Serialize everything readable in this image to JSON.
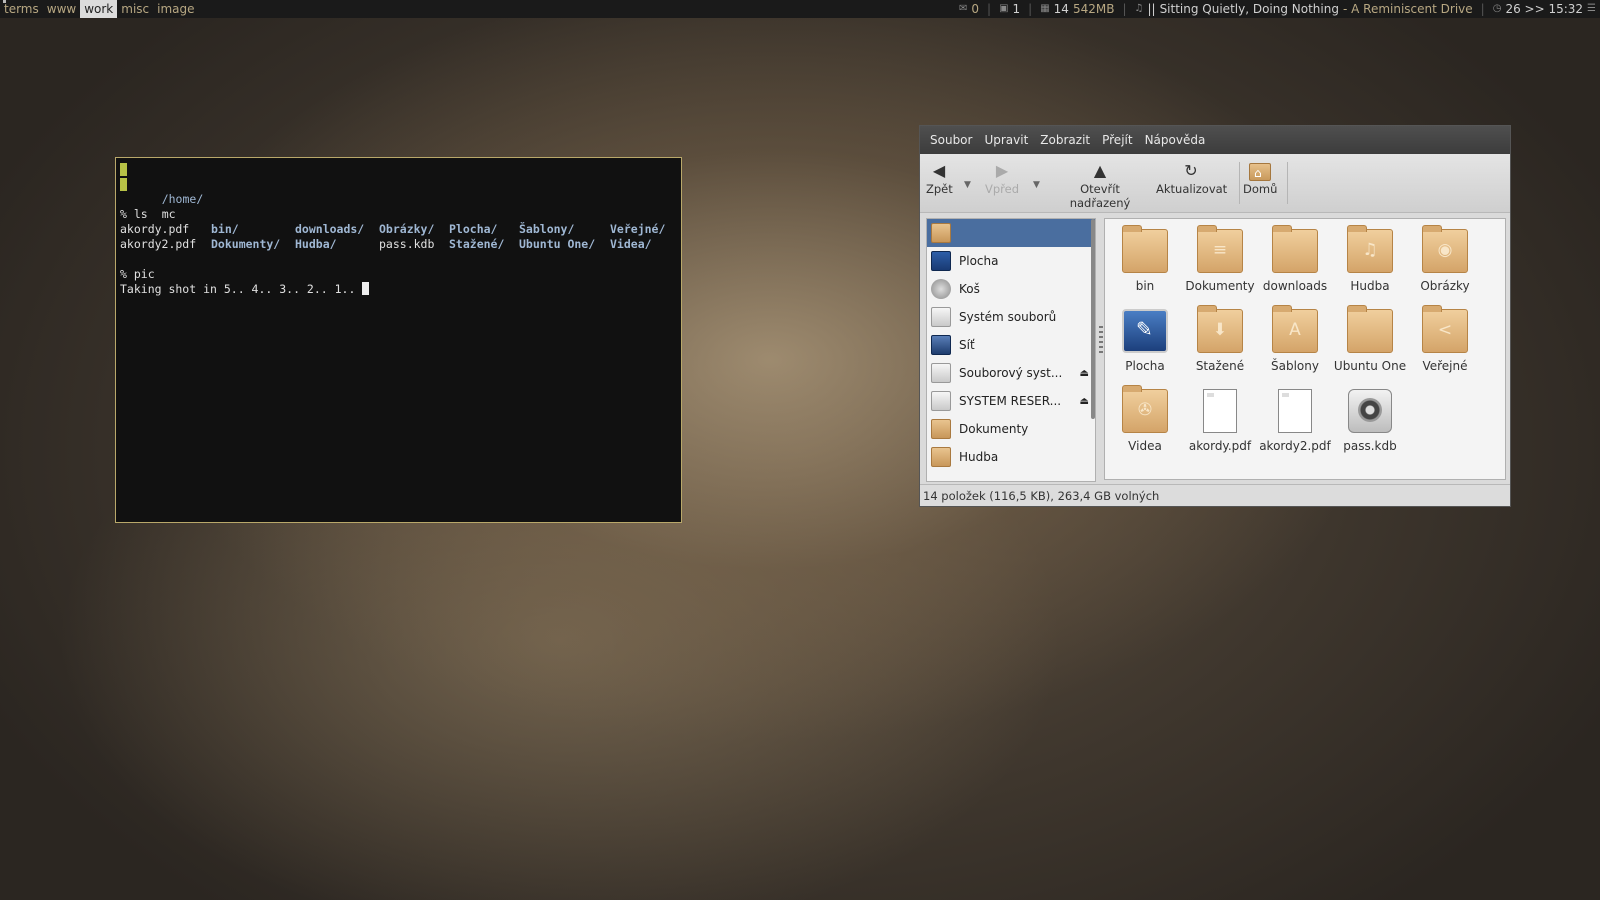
{
  "topbar": {
    "workspaces": [
      "terms",
      "www",
      "work",
      "misc",
      "image"
    ],
    "active_workspace": "work",
    "mail_count": "0",
    "cpu_count": "1",
    "mem_procs": "14",
    "mem_used": "542MB",
    "music_state": "||",
    "song_title": "Sitting Quietly, Doing Nothing",
    "song_artist": "- A Reminiscent Drive",
    "datetime": "26 >> 15:32"
  },
  "terminal": {
    "path": "/home/",
    "mc": "mc",
    "cmd_ls": "% ls",
    "ls_row1": [
      "akordy.pdf",
      "bin/",
      "downloads/",
      "Obrázky/",
      "Plocha/",
      "Šablony/",
      "Veřejné/"
    ],
    "ls_row2": [
      "akordy2.pdf",
      "Dokumenty/",
      "Hudba/",
      "pass.kdb",
      "Stažené/",
      "Ubuntu One/",
      "Videa/"
    ],
    "cmd_pic": "% pic",
    "shot_line": "Taking shot in 5.. 4.. 3.. 2.. 1.. "
  },
  "filemanager": {
    "menu": [
      "Soubor",
      "Upravit",
      "Zobrazit",
      "Přejít",
      "Nápověda"
    ],
    "toolbar": {
      "back": "Zpět",
      "forward": "Vpřed",
      "parent": "Otevřít nadřazený",
      "refresh": "Aktualizovat",
      "home": "Domů"
    },
    "sidebar": [
      {
        "label": "",
        "icon": "home-folder-icon"
      },
      {
        "label": "Plocha",
        "icon": "desktop-icon"
      },
      {
        "label": "Koš",
        "icon": "trash-icon"
      },
      {
        "label": "Systém souborů",
        "icon": "drive-icon"
      },
      {
        "label": "Síť",
        "icon": "network-icon"
      },
      {
        "label": "Souborový syst...",
        "icon": "drive-icon"
      },
      {
        "label": "SYSTEM RESER...",
        "icon": "drive-icon"
      },
      {
        "label": "Dokumenty",
        "icon": "folder-icon"
      },
      {
        "label": "Hudba",
        "icon": "folder-icon"
      }
    ],
    "files": [
      {
        "name": "bin",
        "kind": "folder",
        "emblem": ""
      },
      {
        "name": "Dokumenty",
        "kind": "folder",
        "emblem": "≡"
      },
      {
        "name": "downloads",
        "kind": "folder",
        "emblem": ""
      },
      {
        "name": "Hudba",
        "kind": "folder",
        "emblem": "♫"
      },
      {
        "name": "Obrázky",
        "kind": "folder",
        "emblem": "◉"
      },
      {
        "name": "Plocha",
        "kind": "desktop",
        "emblem": ""
      },
      {
        "name": "Stažené",
        "kind": "folder",
        "emblem": "⬇"
      },
      {
        "name": "Šablony",
        "kind": "folder",
        "emblem": "A"
      },
      {
        "name": "Ubuntu One",
        "kind": "folder",
        "emblem": ""
      },
      {
        "name": "Veřejné",
        "kind": "folder",
        "emblem": "<"
      },
      {
        "name": "Videa",
        "kind": "folder",
        "emblem": "✇"
      },
      {
        "name": "akordy.pdf",
        "kind": "doc",
        "emblem": ""
      },
      {
        "name": "akordy2.pdf",
        "kind": "doc",
        "emblem": ""
      },
      {
        "name": "pass.kdb",
        "kind": "safe",
        "emblem": ""
      }
    ],
    "status": "14 položek (116,5 KB), 263,4 GB volných"
  }
}
